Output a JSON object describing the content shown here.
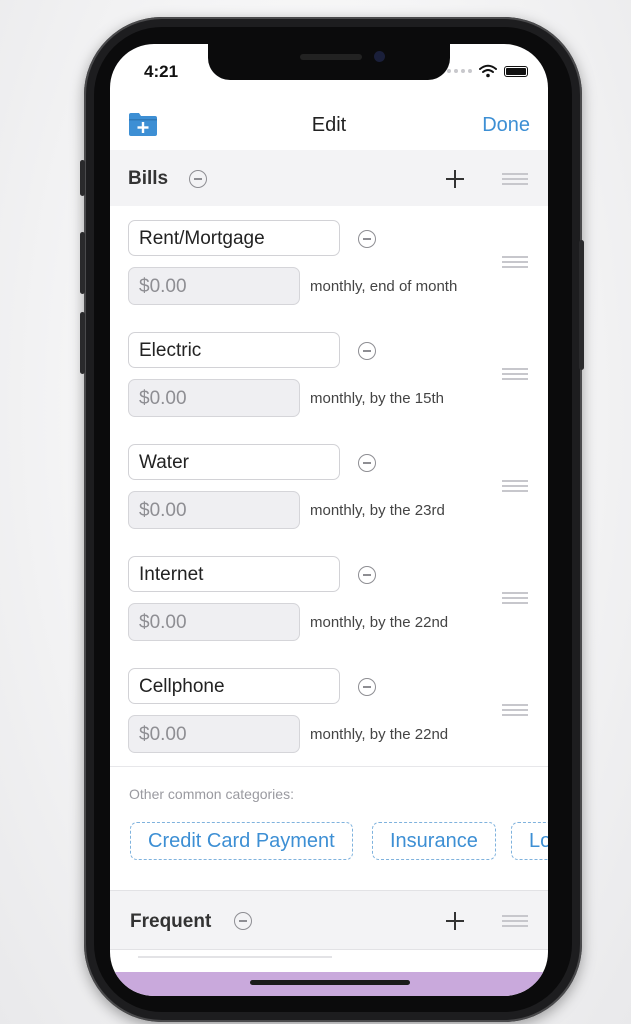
{
  "status": {
    "time": "4:21"
  },
  "nav": {
    "title": "Edit",
    "done_label": "Done"
  },
  "sections": {
    "bills": {
      "title": "Bills"
    },
    "frequent": {
      "title": "Frequent"
    }
  },
  "bills": [
    {
      "name": "Rent/Mortgage",
      "amount": "$0.00",
      "frequency": "monthly, end of month"
    },
    {
      "name": "Electric",
      "amount": "$0.00",
      "frequency": "monthly, by the 15th"
    },
    {
      "name": "Water",
      "amount": "$0.00",
      "frequency": "monthly, by the 23rd"
    },
    {
      "name": "Internet",
      "amount": "$0.00",
      "frequency": "monthly, by the 22nd"
    },
    {
      "name": "Cellphone",
      "amount": "$0.00",
      "frequency": "monthly, by the 22nd"
    }
  ],
  "other_categories": {
    "label": "Other common categories:",
    "chips": [
      "Credit Card Payment",
      "Insurance",
      "Lo"
    ]
  },
  "colors": {
    "accent": "#3d8fd4",
    "bottom_bar": "#c9a9dc"
  }
}
